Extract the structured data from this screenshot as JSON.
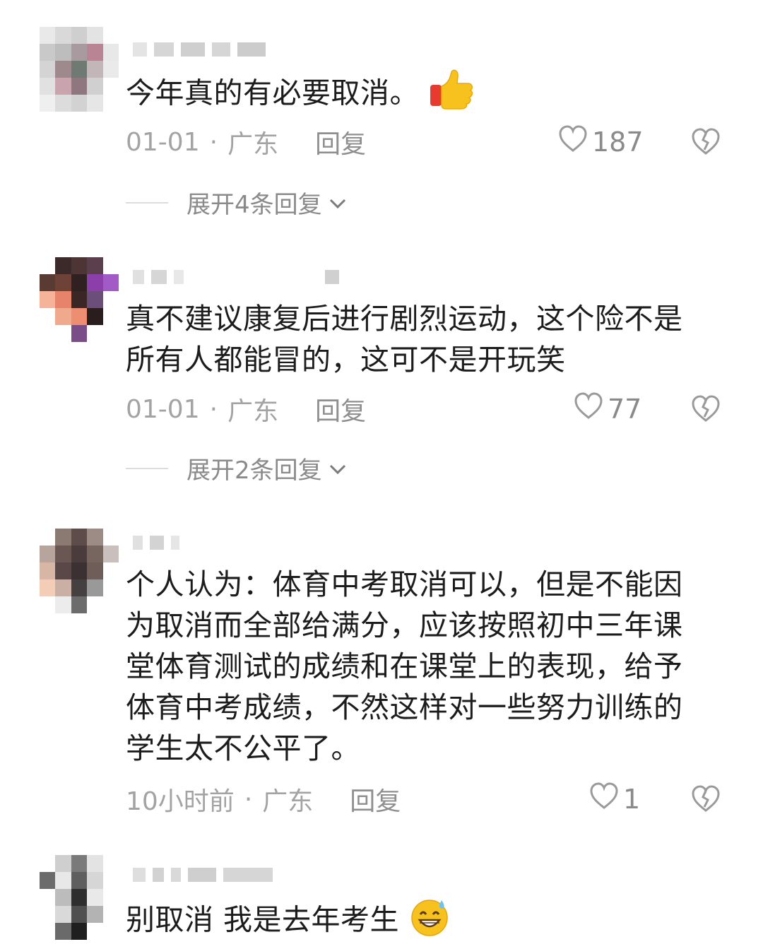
{
  "comments": [
    {
      "text": "今年真的有必要取消。",
      "emoji": "thumbs-up",
      "time": "01-01",
      "location": "广东",
      "reply_label": "回复",
      "likes": "187",
      "expand": "展开4条回复"
    },
    {
      "text_lines": [
        "真不建议康复后进行剧烈运动，这个险不是",
        "所有人都能冒的，这可不是开玩笑"
      ],
      "time": "01-01",
      "location": "广东",
      "reply_label": "回复",
      "likes": "77",
      "expand": "展开2条回复"
    },
    {
      "text_lines": [
        "个人认为：体育中考取消可以，但是不能因",
        "为取消而全部给满分，应该按照初中三年课",
        "堂体育测试的成绩和在课堂上的表现，给予",
        "体育中考成绩，不然这样对一些努力训练的",
        "学生太不公平了。"
      ],
      "time": "10小时前",
      "location": "广东",
      "reply_label": "回复",
      "likes": "1"
    },
    {
      "text": "别取消 我是去年考生",
      "emoji": "grinning-sweat"
    }
  ],
  "separator": "·",
  "icons": {
    "like": "heart-outline-icon",
    "dislike": "broken-heart-icon",
    "expand": "chevron-down-icon"
  },
  "colors": {
    "text": "#1c1c1c",
    "meta": "#a3a3a3",
    "emoji_yellow": "#f7c21d",
    "emoji_red": "#e63b2e"
  }
}
